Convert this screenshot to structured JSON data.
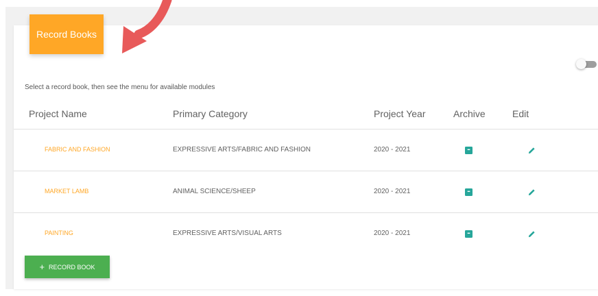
{
  "header": {
    "title": "Record Books"
  },
  "instructions": "Select a record book, then see the menu for available modules",
  "table": {
    "columns": [
      "Project Name",
      "Primary Category",
      "Project Year",
      "Archive",
      "Edit"
    ],
    "rows": [
      {
        "name": "FABRIC AND FASHION",
        "category": "EXPRESSIVE ARTS/FABRIC AND FASHION",
        "year": "2020 - 2021"
      },
      {
        "name": "MARKET LAMB",
        "category": "ANIMAL SCIENCE/SHEEP",
        "year": "2020 - 2021"
      },
      {
        "name": "PAINTING",
        "category": "EXPRESSIVE ARTS/VISUAL ARTS",
        "year": "2020 - 2021"
      }
    ]
  },
  "add_button": {
    "plus": "+",
    "label": "RECORD BOOK"
  },
  "colors": {
    "accent": "#ffa726",
    "teal": "#26a69a",
    "green": "#4caf50",
    "arrow": "#e85a5a"
  },
  "icons": {
    "archive": "archive-box-icon",
    "edit": "pencil-icon",
    "arrow": "curved-arrow-icon"
  }
}
